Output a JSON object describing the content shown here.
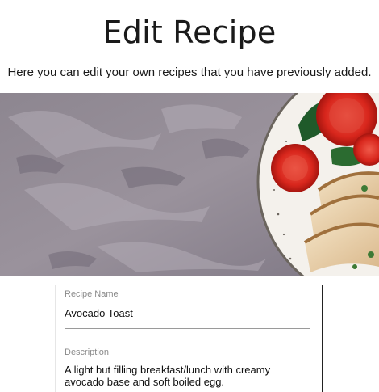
{
  "page": {
    "title": "Edit Recipe",
    "subtitle": "Here you can edit your own recipes that you have previously added."
  },
  "hero": {
    "image": "grilled-chicken-tomato-plate-on-stone-background"
  },
  "form": {
    "recipe_name": {
      "label": "Recipe Name",
      "value": "Avocado Toast"
    },
    "description": {
      "label": "Description",
      "value": "A light but filling breakfast/lunch with creamy avocado base and soft boiled egg."
    }
  }
}
